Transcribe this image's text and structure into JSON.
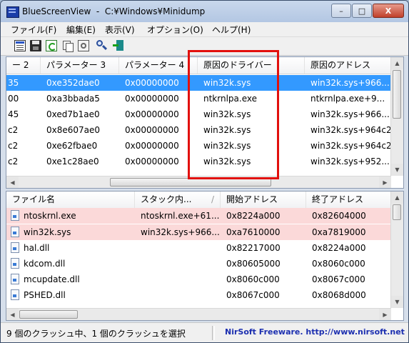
{
  "window": {
    "title": "BlueScreenView  -  C:¥Windows¥Minidump"
  },
  "title_buttons": {
    "minimize": "–",
    "maximize": "□",
    "close": "X"
  },
  "menu": [
    "ファイル(F)",
    "編集(E)",
    "表示(V)",
    "オプション(O)",
    "ヘルプ(H)"
  ],
  "toolbar": [
    "save-html-report-icon",
    "save-icon",
    "refresh-icon",
    "copy-icon",
    "properties-icon",
    "find-icon",
    "exit-icon"
  ],
  "top_list": {
    "headers": [
      "ー 2",
      "パラメーター 3",
      "パラメーター 4",
      "原因のドライバー",
      "原因のアドレス"
    ],
    "rows": [
      [
        "35",
        "0xe352dae0",
        "0x00000000",
        "win32k.sys",
        "win32k.sys+966..."
      ],
      [
        "00",
        "0xa3bbada5",
        "0x00000000",
        "ntkrnlpa.exe",
        "ntkrnlpa.exe+9..."
      ],
      [
        "45",
        "0xed7b1ae0",
        "0x00000000",
        "win32k.sys",
        "win32k.sys+966..."
      ],
      [
        "c2",
        "0x8e607ae0",
        "0x00000000",
        "win32k.sys",
        "win32k.sys+964c2"
      ],
      [
        "c2",
        "0xe62fbae0",
        "0x00000000",
        "win32k.sys",
        "win32k.sys+964c2"
      ],
      [
        "c2",
        "0xe1c28ae0",
        "0x00000000",
        "win32k.sys",
        "win32k.sys+952..."
      ]
    ]
  },
  "bottom_list": {
    "headers": [
      "ファイル名",
      "スタック内...",
      "/",
      "開始アドレス",
      "終了アドレス"
    ],
    "rows": [
      [
        "ntoskrnl.exe",
        "ntoskrnl.exe+61...",
        "0x8224a000",
        "0x82604000"
      ],
      [
        "win32k.sys",
        "win32k.sys+966...",
        "0xa7610000",
        "0xa7819000"
      ],
      [
        "hal.dll",
        "",
        "0x82217000",
        "0x8224a000"
      ],
      [
        "kdcom.dll",
        "",
        "0x80605000",
        "0x8060c000"
      ],
      [
        "mcupdate.dll",
        "",
        "0x8060c000",
        "0x8067c000"
      ],
      [
        "PSHED.dll",
        "",
        "0x8067c000",
        "0x8068d000"
      ]
    ]
  },
  "status": {
    "left": "9 個のクラッシュ中、1 個のクラッシュを選択",
    "right": "NirSoft Freeware.  http://www.nirsoft.net"
  },
  "colors": {
    "selected_row": "#3399ff",
    "highlight_row": "#fbd9d9",
    "annotation": "#e2100d",
    "link": "#1c2fb0"
  }
}
